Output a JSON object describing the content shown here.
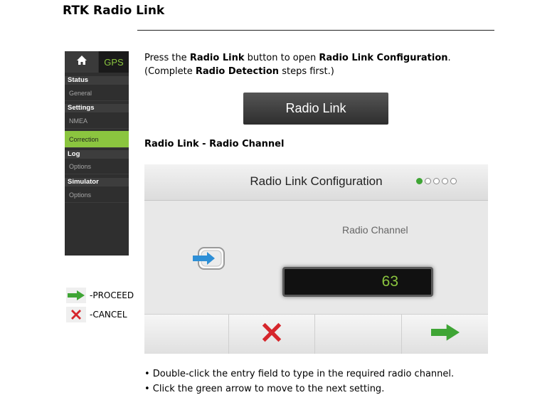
{
  "doc_title": "RTK Radio Link",
  "sidebar": {
    "gps_label": "GPS",
    "sections": [
      {
        "header": "Status",
        "items": [
          "General"
        ]
      },
      {
        "header": "Settings",
        "items": [
          "NMEA",
          "Correction"
        ]
      },
      {
        "header": "Log",
        "items": [
          "Options"
        ]
      },
      {
        "header": "Simulator",
        "items": [
          "Options"
        ]
      }
    ],
    "selected": "Correction"
  },
  "legend": {
    "proceed": "-PROCEED",
    "cancel": "-CANCEL"
  },
  "intro": {
    "t1": "Press the ",
    "b1": "Radio Link",
    "t2": " button to open ",
    "b2": "Radio Link Configuration",
    "t3": ". (Complete ",
    "b3": "Radio Detection",
    "t4": " steps first.)"
  },
  "radio_link_button": "Radio Link",
  "section_heading": "Radio Link - Radio Channel",
  "panel": {
    "title": "Radio Link Configuration",
    "page_total": 5,
    "page_current": 1,
    "channel_label": "Radio Channel",
    "channel_value": "63"
  },
  "bullets": [
    "• Double-click the entry field to type in the required radio channel.",
    "• Click the green arrow to move to the next setting."
  ],
  "colors": {
    "accent_green": "#8bc53f",
    "cancel_red": "#d6262c",
    "proceed_green": "#3fa535"
  }
}
